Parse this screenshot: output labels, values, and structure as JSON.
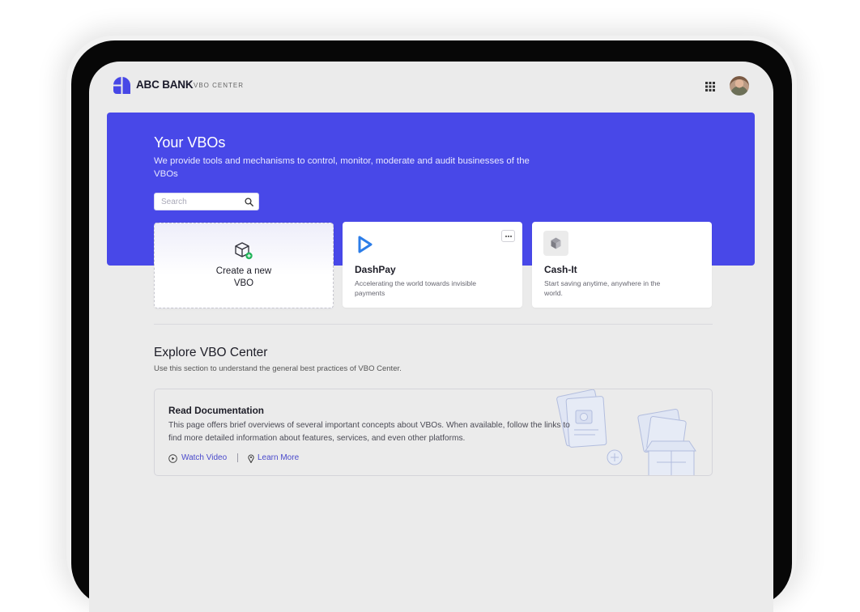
{
  "header": {
    "brand": "ABC BANK",
    "product": "VBO CENTER"
  },
  "hero": {
    "title": "Your VBOs",
    "description": "We provide tools and mechanisms to control, monitor, moderate and audit businesses of the VBOs",
    "search_placeholder": "Search"
  },
  "cards": {
    "create_line1": "Create a new",
    "create_line2": "VBO",
    "dashpay": {
      "name": "DashPay",
      "description": "Accelerating the world towards invisible payments"
    },
    "cashit": {
      "name": "Cash-It",
      "description": "Start saving anytime, anywhere in the world."
    }
  },
  "explore": {
    "title": "Explore VBO Center",
    "subtitle": "Use this section to understand the  general best practices of VBO Center.",
    "doc": {
      "title": "Read Documentation",
      "description": "This page offers brief overviews of several important concepts about VBOs. When available, follow the links to find more detailed information about features, services, and even other platforms.",
      "watch_video": "Watch Video",
      "learn_more": "Learn More"
    }
  },
  "colors": {
    "accent": "#4848e8",
    "link": "#4a4acc",
    "screen_bg": "#ebebeb",
    "success": "#22b45a"
  },
  "icons": [
    "logo-mark",
    "apps-grid-icon",
    "user-avatar",
    "search-icon",
    "box-plus-icon",
    "dashpay-logo-icon",
    "more-icon",
    "cube-icon",
    "play-icon",
    "pin-icon"
  ]
}
